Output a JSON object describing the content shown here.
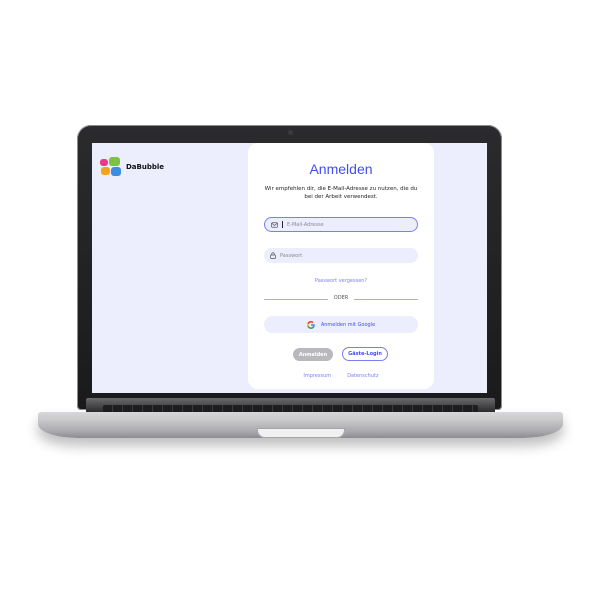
{
  "app": {
    "name": "DaBubble"
  },
  "login": {
    "title": "Anmelden",
    "subtitle": "Wir empfehlen dir, die E-Mail-Adresse zu nutzen, die du bei der Arbeit verwendest.",
    "email_placeholder": "E-Mail-Adresse",
    "password_placeholder": "Passwort",
    "forgot_password": "Passwort vergessen?",
    "divider": "ODER",
    "google_button": "Anmelden mit Google",
    "login_button": "Anmelden",
    "guest_button": "Gäste-Login"
  },
  "footer": {
    "imprint": "Impressum",
    "privacy": "Datenschutz"
  },
  "icons": {
    "email": "mail-icon",
    "password": "lock-icon",
    "google": "google-icon"
  },
  "colors": {
    "accent": "#444df2",
    "accent_light": "#797ef3",
    "background": "#eceefe",
    "card": "#ffffff",
    "disabled_button": "#b9b9bd"
  }
}
